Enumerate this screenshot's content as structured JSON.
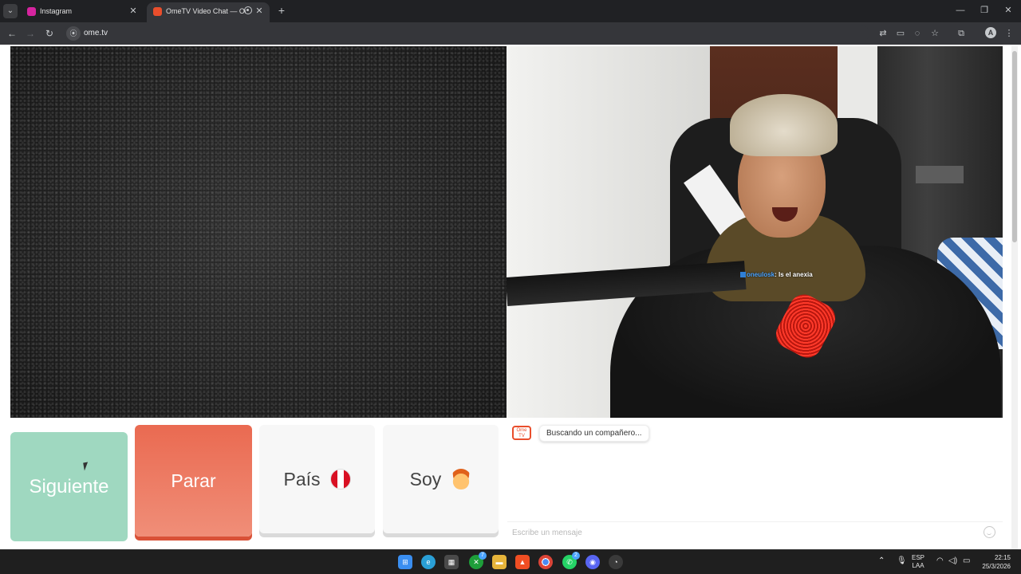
{
  "browser": {
    "tabs": [
      {
        "title": "Instagram",
        "favicon_color": "#d6249f",
        "close": "✕"
      },
      {
        "title": "OmeTV Video Chat — Ome",
        "favicon_color": "#e94e2c",
        "close": "✕"
      }
    ],
    "tab_menu_icon": "⌄",
    "new_tab": "+",
    "window_controls": {
      "minimize": "—",
      "restore": "❐",
      "close": "✕"
    },
    "nav": {
      "back": "←",
      "forward": "→",
      "reload": "↻"
    },
    "url": "ome.tv",
    "toolbar_icons": [
      "translate-icon",
      "cast-icon",
      "eye-off-icon",
      "bookmark-star-icon",
      "extensions-icon"
    ],
    "profile_initial": "A",
    "menu": "⋮"
  },
  "video": {
    "overlay_name": "oneulosk",
    "overlay_message": ": Is el anexia"
  },
  "controls": {
    "next_label": "Siguiente",
    "stop_label": "Parar",
    "country_label": "País",
    "gender_label": "Soy"
  },
  "chat": {
    "logo_text_top": "Ome",
    "logo_text_bottom": "TV",
    "status_message": "Buscando un compañero...",
    "input_placeholder": "Escribe un mensaje"
  },
  "taskbar": {
    "badges": {
      "xbox": "7",
      "whatsapp": "2"
    },
    "language_top": "ESP",
    "language_bottom": "LAA",
    "time": "22:15",
    "date": "25/3/2026"
  }
}
